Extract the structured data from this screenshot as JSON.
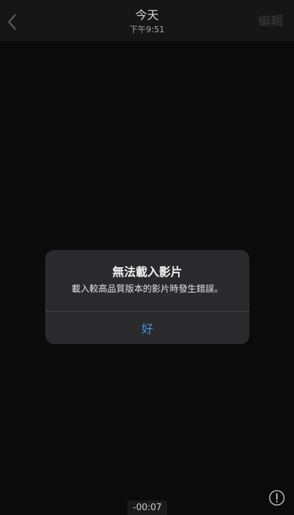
{
  "navbar": {
    "title": "今天",
    "subtitle": "下午9:51",
    "edit_label": "編輯",
    "back_icon": "chevron-left-icon"
  },
  "alert": {
    "title": "無法載入影片",
    "message": "載入較高品質版本的影片時發生錯誤。",
    "ok_label": "好"
  },
  "player": {
    "timecode": "-00:07",
    "info_icon": "exclamation-circle-icon"
  },
  "colors": {
    "background": "#0b0b0b",
    "navbar": "#161616",
    "alert_bg": "#2a2a2c",
    "accent": "#4a90e2"
  }
}
